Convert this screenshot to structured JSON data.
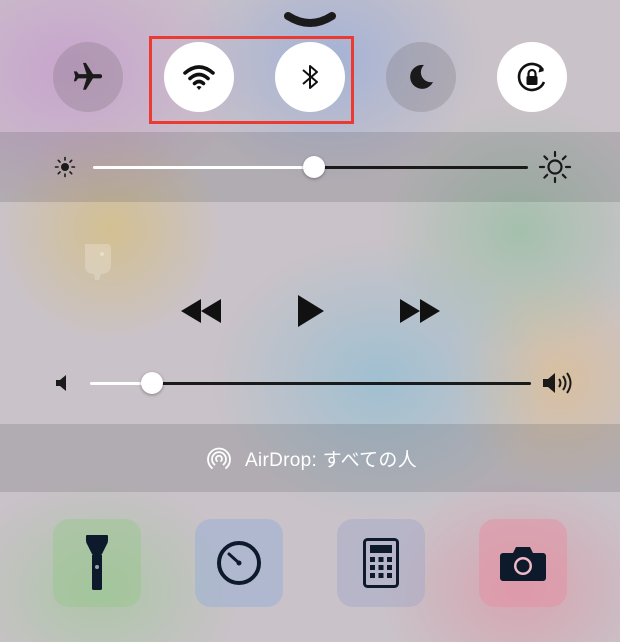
{
  "toggles": [
    {
      "name": "airplane-mode",
      "icon": "airplane-icon",
      "state": "off"
    },
    {
      "name": "wifi",
      "icon": "wifi-icon",
      "state": "on"
    },
    {
      "name": "bluetooth",
      "icon": "bluetooth-icon",
      "state": "on"
    },
    {
      "name": "do-not-disturb",
      "icon": "moon-icon",
      "state": "off"
    },
    {
      "name": "rotation-lock",
      "icon": "rotation-lock-icon",
      "state": "on"
    }
  ],
  "brightness": {
    "level": 0.51,
    "low_icon": "sun-small-icon",
    "high_icon": "sun-large-icon"
  },
  "media": {
    "artwork_icon": "elephant-app-icon",
    "controls": [
      "rewind-icon",
      "play-icon",
      "fast-forward-icon"
    ]
  },
  "volume": {
    "level": 0.14,
    "low_icon": "speaker-low-icon",
    "high_icon": "speaker-high-icon"
  },
  "airdrop": {
    "label": "AirDrop: すべての人",
    "icon": "airdrop-icon"
  },
  "shortcuts": [
    "flashlight-icon",
    "timer-icon",
    "calculator-icon",
    "camera-icon"
  ],
  "colors": {
    "highlight_border": "#ea3a32",
    "active_icon": "#111111",
    "inactive_icon": "#1a1a1a"
  }
}
